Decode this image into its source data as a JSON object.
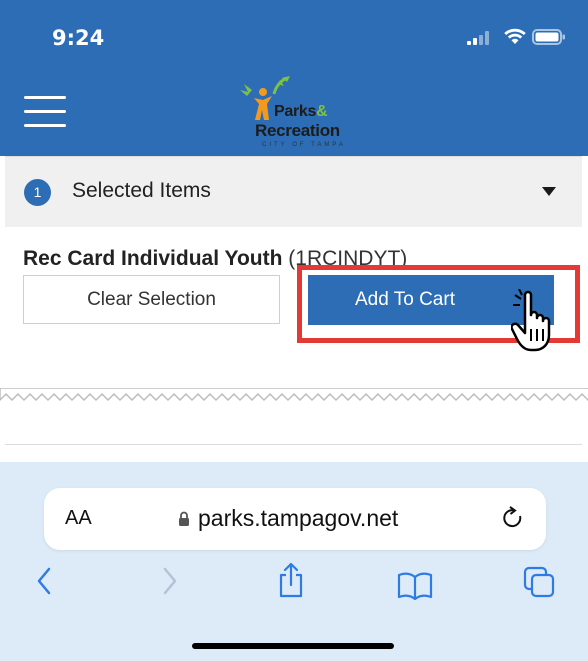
{
  "status_bar": {
    "time": "9:24"
  },
  "header": {
    "logo": {
      "line1": "Parks",
      "line1_amp": "&",
      "line2": "Recreation",
      "line3": "CITY OF TAMPA"
    },
    "colors": {
      "primary": "#2c6db5",
      "logo_green": "#7ec242",
      "logo_orange": "#f39a1e"
    }
  },
  "selected_items": {
    "count": "1",
    "label": "Selected Items"
  },
  "item": {
    "title": "Rec Card Individual Youth",
    "code": "(1RCINDYT)"
  },
  "buttons": {
    "clear": "Clear Selection",
    "add": "Add To Cart"
  },
  "annotation": {
    "highlight_color": "#e53935"
  },
  "safari": {
    "text_size": "AA",
    "url": "parks.tampagov.net",
    "toolbar": [
      "back-icon",
      "forward-icon",
      "share-icon",
      "bookmarks-icon",
      "tabs-icon"
    ]
  }
}
